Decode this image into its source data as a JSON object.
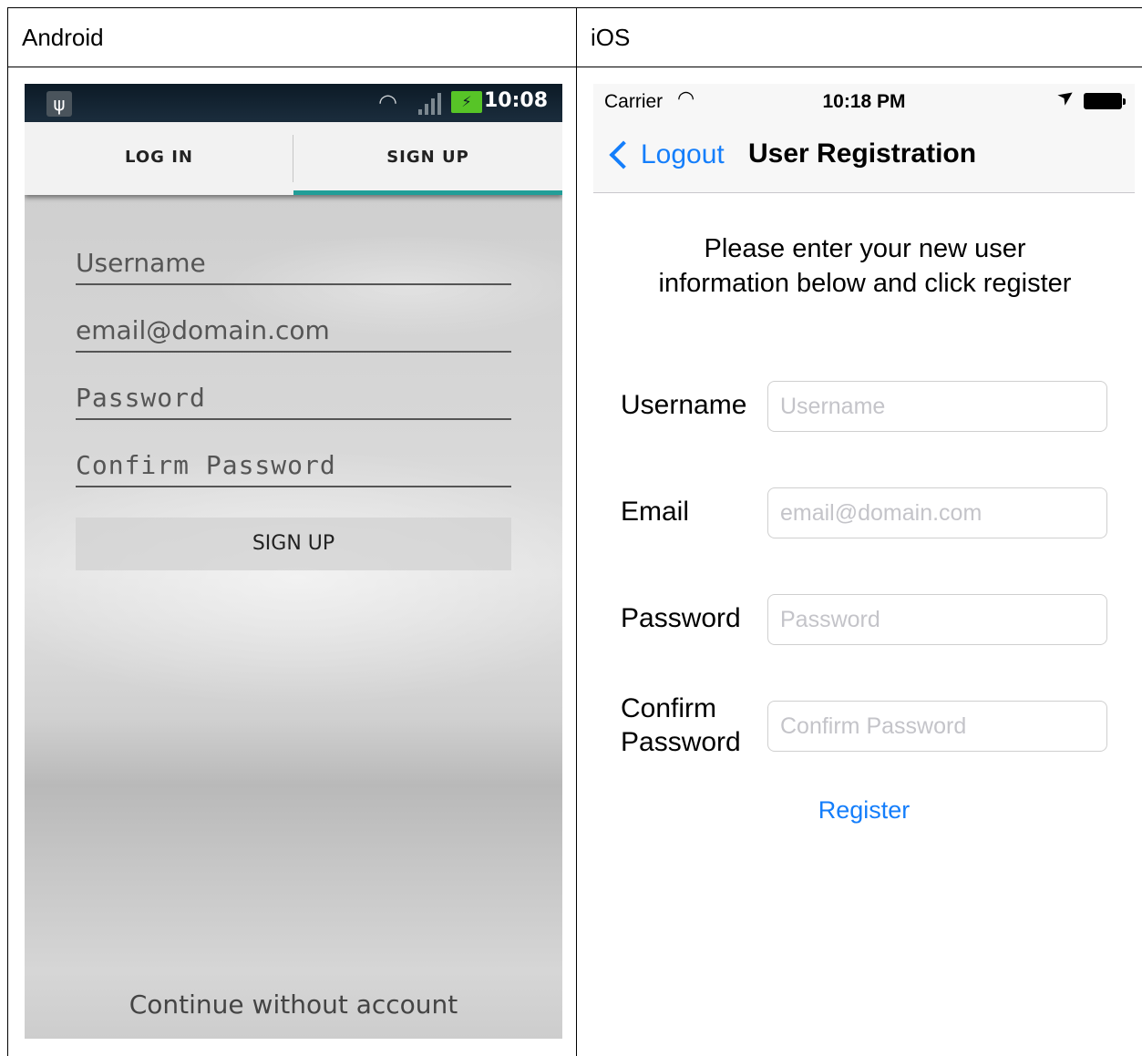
{
  "columns": {
    "android": "Android",
    "ios": "iOS"
  },
  "android": {
    "status": {
      "time": "10:08",
      "usb_icon": "usb-icon",
      "wifi_icon": "wifi-icon",
      "signal_icon": "signal-icon",
      "battery_icon": "battery-charging-icon"
    },
    "tabs": {
      "login": "LOG IN",
      "signup": "SIGN UP",
      "active": "signup",
      "indicator_color": "#229e98"
    },
    "fields": {
      "username_placeholder": "Username",
      "email_placeholder": "email@domain.com",
      "password_placeholder": "Password",
      "confirm_password_placeholder": "Confirm Password"
    },
    "signup_button": "SIGN UP",
    "continue_link": "Continue without account"
  },
  "ios": {
    "status": {
      "carrier": "Carrier",
      "time": "10:18 PM",
      "wifi_icon": "wifi-icon",
      "location_icon": "location-arrow-icon",
      "battery_icon": "battery-icon"
    },
    "nav": {
      "back_label": "Logout",
      "title": "User Registration",
      "tint_color": "#147efb"
    },
    "instructions": "Please enter your new user information below and click register",
    "form": {
      "username_label": "Username",
      "username_placeholder": "Username",
      "email_label": "Email",
      "email_placeholder": "email@domain.com",
      "password_label": "Password",
      "password_placeholder": "Password",
      "confirm_label_line1": "Confirm",
      "confirm_label_line2": "Password",
      "confirm_placeholder": "Confirm Password"
    },
    "register_button": "Register"
  }
}
